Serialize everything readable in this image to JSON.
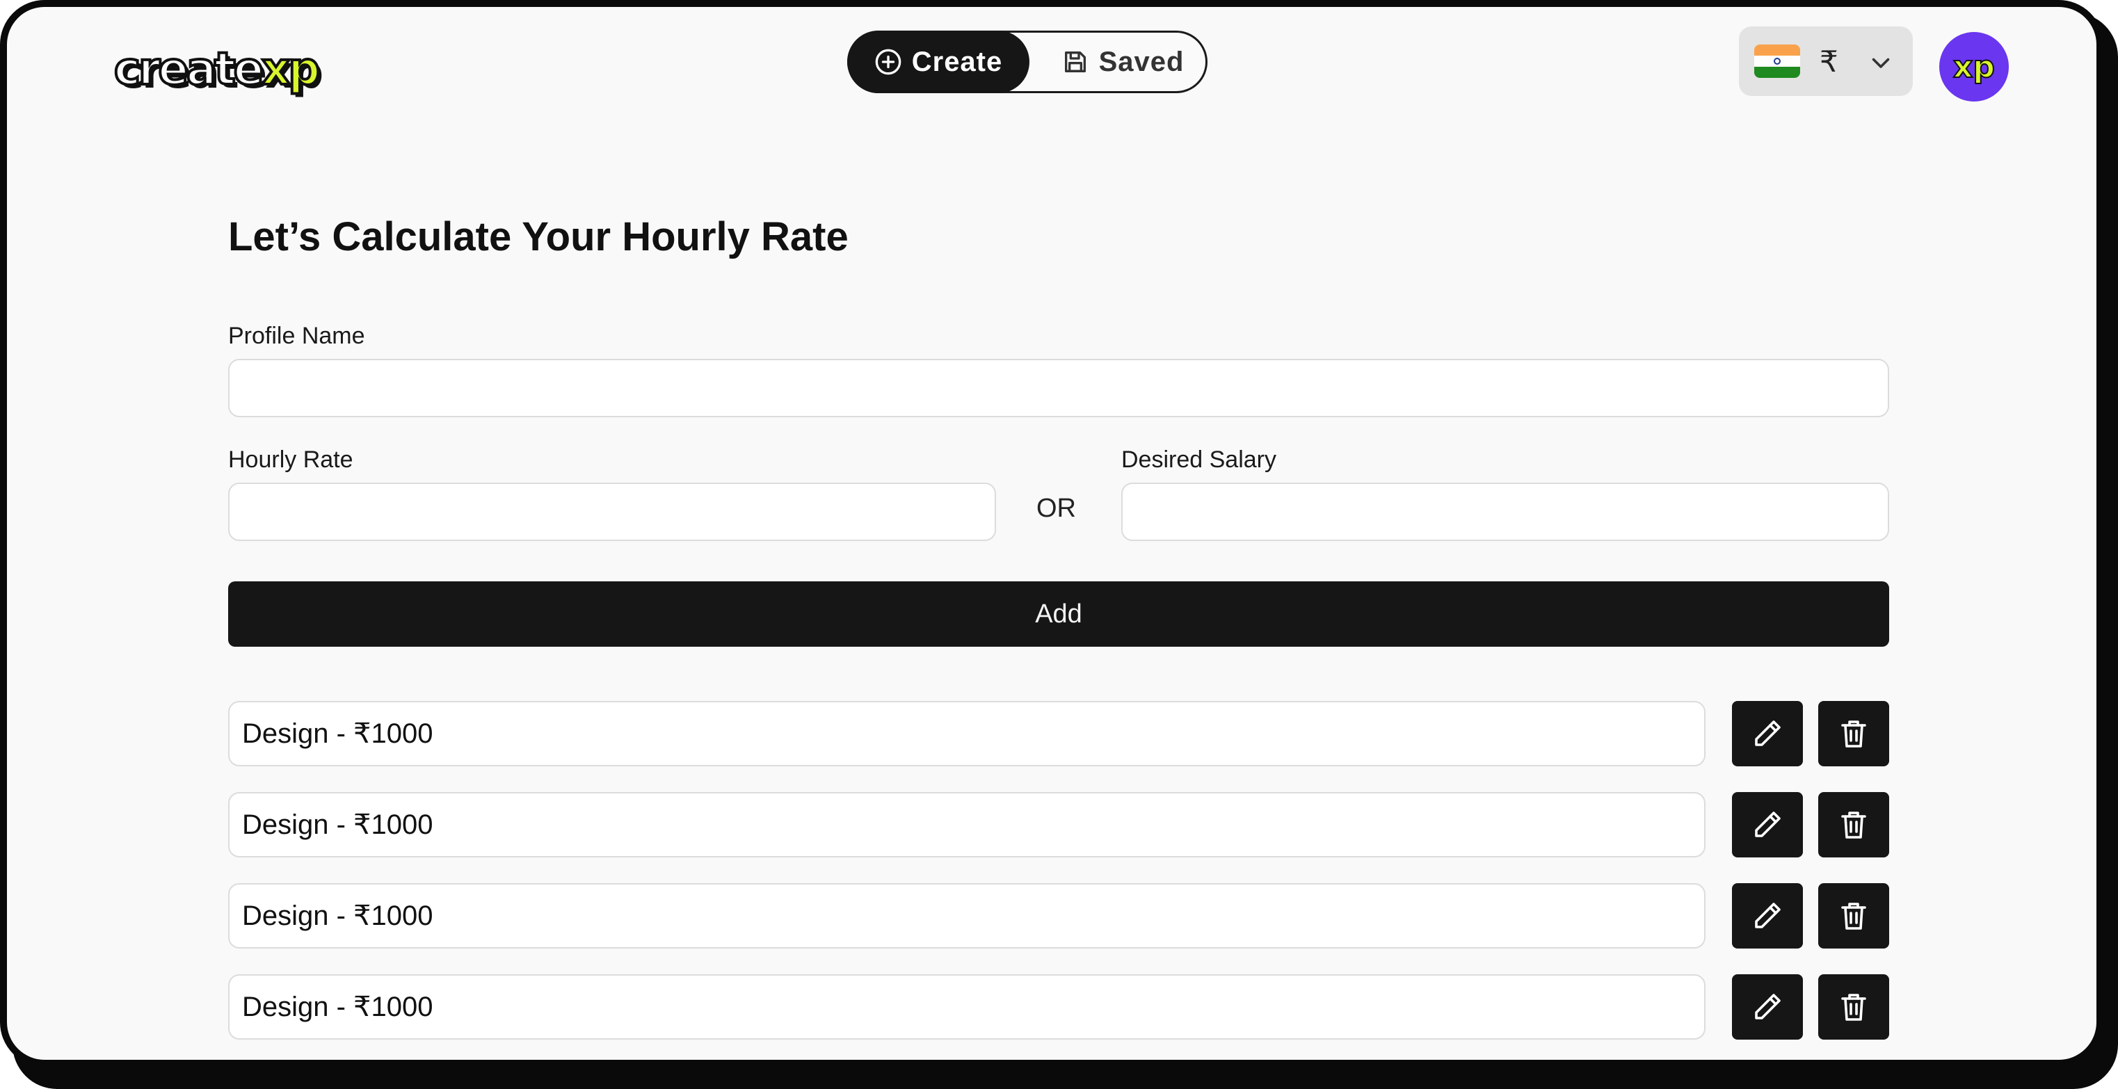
{
  "brand": {
    "logo_part1": "create",
    "logo_part2": "xp"
  },
  "header": {
    "nav": {
      "create_label": "Create",
      "saved_label": "Saved"
    },
    "currency": {
      "symbol": "₹",
      "flag": "india-flag-icon"
    },
    "avatar_text": "xp"
  },
  "form": {
    "title": "Let’s Calculate Your Hourly Rate",
    "profile_name_label": "Profile Name",
    "profile_name_value": "",
    "hourly_rate_label": "Hourly Rate",
    "hourly_rate_value": "",
    "or_label": "OR",
    "desired_salary_label": "Desired Salary",
    "desired_salary_value": "",
    "add_label": "Add"
  },
  "rates": [
    {
      "text": "Design - ₹1000"
    },
    {
      "text": "Design - ₹1000"
    },
    {
      "text": "Design - ₹1000"
    },
    {
      "text": "Design - ₹1000"
    }
  ],
  "icons": {
    "create": "plus-circle-icon",
    "saved": "floppy-disk-icon",
    "chevron": "chevron-down-icon",
    "edit": "pencil-icon",
    "delete": "trash-icon"
  },
  "colors": {
    "dark": "#161616",
    "accent_lime": "#d9f52c",
    "avatar_purple": "#6a36ef",
    "background": "#f9f9f9"
  }
}
